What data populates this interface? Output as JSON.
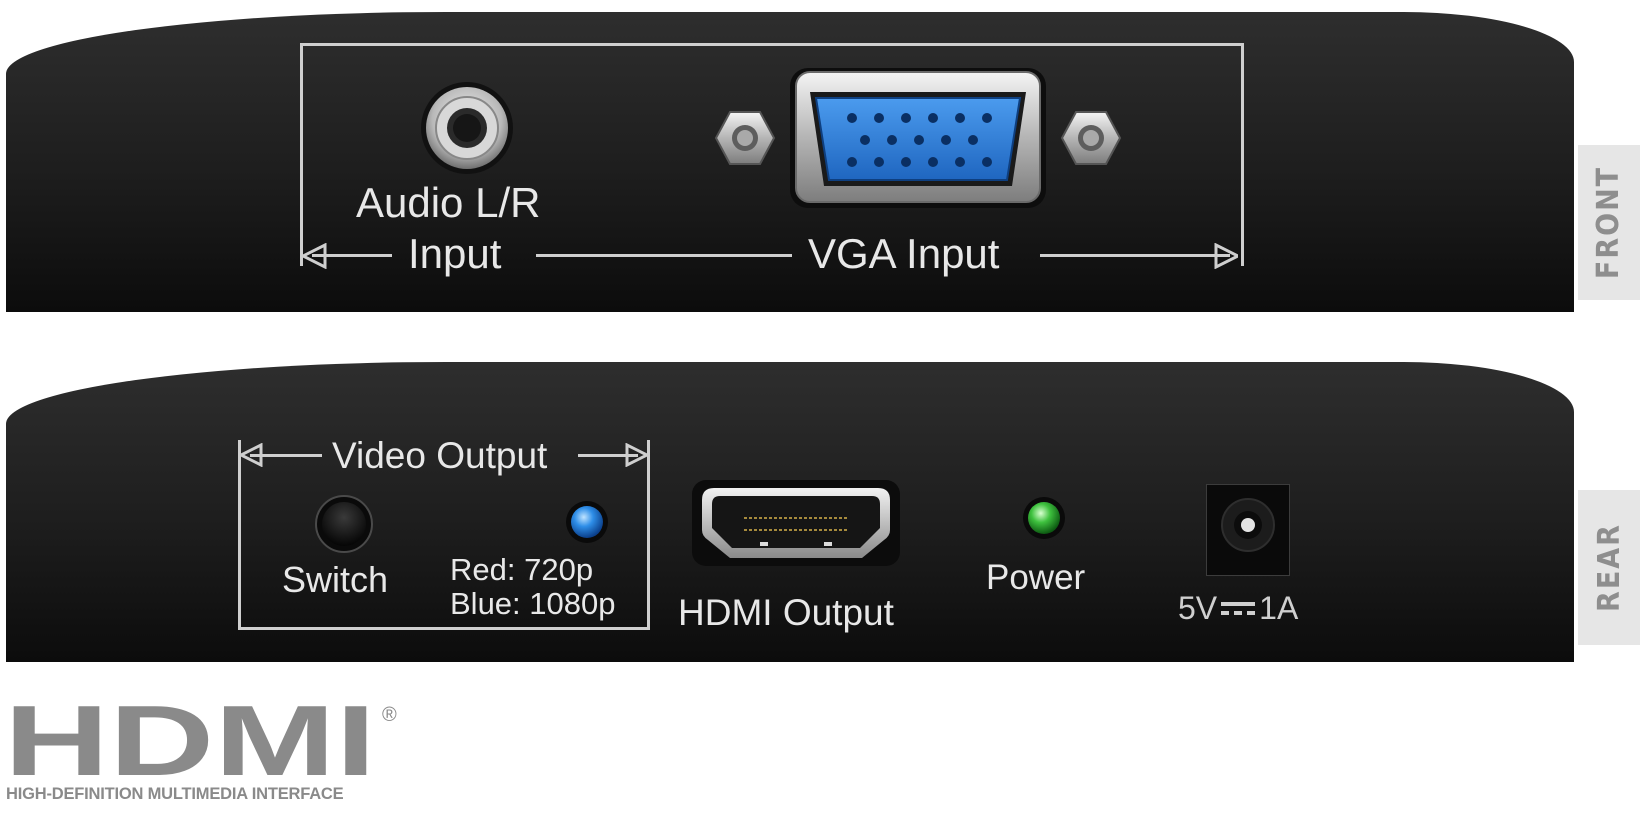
{
  "front": {
    "side_label": "FRONT",
    "audio_label_line1": "Audio L/R",
    "audio_label_line2": "Input",
    "vga_label": "VGA Input"
  },
  "rear": {
    "side_label": "REAR",
    "video_output_label": "Video Output",
    "switch_label": "Switch",
    "led_legend_line1": "Red: 720p",
    "led_legend_line2": "Blue: 1080p",
    "hdmi_output_label": "HDMI Output",
    "power_label": "Power",
    "dc_voltage": "5V",
    "dc_current": "1A"
  },
  "logo": {
    "wordmark": "HDMI",
    "registered": "®",
    "tagline": "HIGH-DEFINITION MULTIMEDIA INTERFACE"
  },
  "colors": {
    "panel": "#1d1d1d",
    "label": "#e8e8e8",
    "vga_connector": "#2f7fd6",
    "blue_led": "#2e8ee8",
    "green_led": "#3ec13e",
    "logo_gray": "#8a8a8a"
  }
}
